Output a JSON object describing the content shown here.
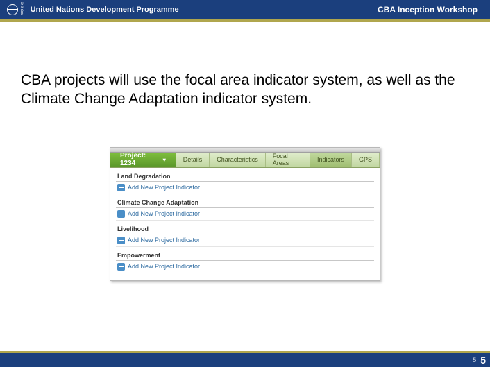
{
  "header": {
    "org_name": "United Nations Development Programme",
    "logo_l1": "U",
    "logo_l2": "N",
    "logo_l3": "D",
    "logo_l4": "P",
    "workshop": "CBA Inception Workshop"
  },
  "body_text": "CBA projects will use the focal area indicator system, as well as the Climate Change Adaptation indicator system.",
  "app": {
    "project_label": "Project: 1234",
    "tabs": {
      "details": "Details",
      "characteristics": "Characteristics",
      "focal_areas": "Focal Areas",
      "indicators": "Indicators",
      "gps": "GPS"
    },
    "sections": [
      {
        "title": "Land Degradation",
        "action": "Add New Project Indicator"
      },
      {
        "title": "Climate Change Adaptation",
        "action": "Add New Project Indicator"
      },
      {
        "title": "Livelihood",
        "action": "Add New Project Indicator"
      },
      {
        "title": "Empowerment",
        "action": "Add New Project Indicator"
      }
    ]
  },
  "footer": {
    "page_small": "5",
    "page": "5"
  }
}
